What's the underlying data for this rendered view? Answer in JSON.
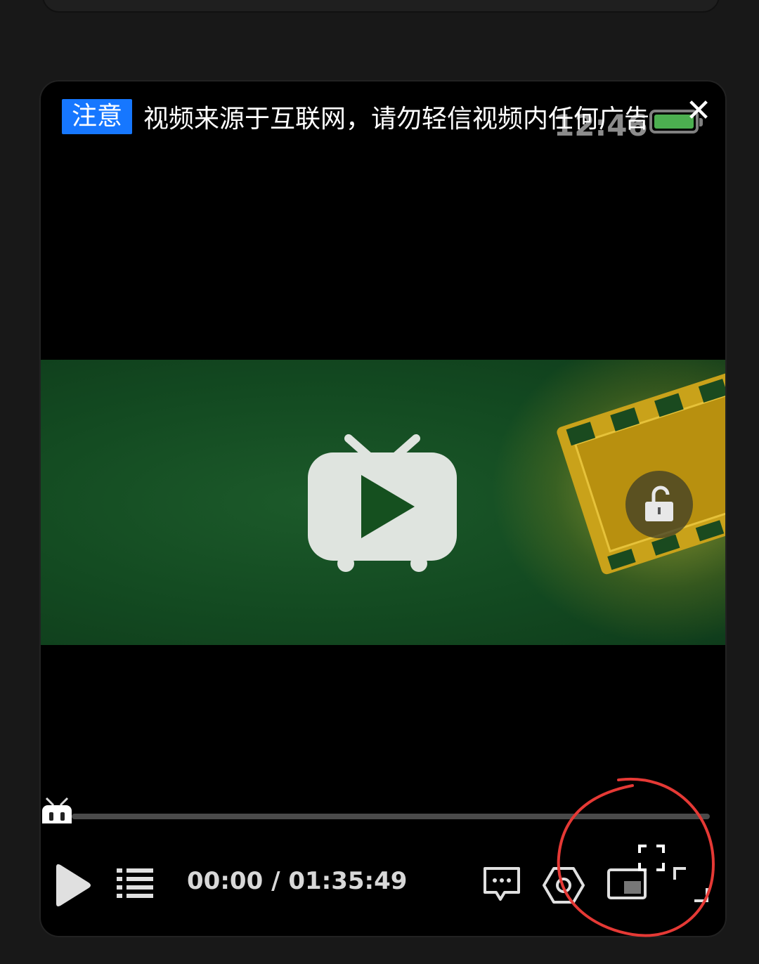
{
  "notice": {
    "badge": "注意",
    "text": "视频来源于互联网，请勿轻信视频内任何广告"
  },
  "status": {
    "clock": "12:46"
  },
  "player": {
    "time_display": "00:00 / 01:35:49",
    "progress": 0
  },
  "icons": {
    "close": "close-icon",
    "center_play": "tv-play-icon",
    "lock": "lock-icon",
    "play": "play-icon",
    "playlist": "playlist-icon",
    "danmaku": "danmaku-icon",
    "settings": "settings-icon",
    "pip": "picture-in-picture-icon",
    "fullscreen": "fullscreen-icon",
    "rotate": "rotate-fullscreen-icon"
  },
  "colors": {
    "accent": "#1677ff",
    "annotation": "#e53935"
  }
}
